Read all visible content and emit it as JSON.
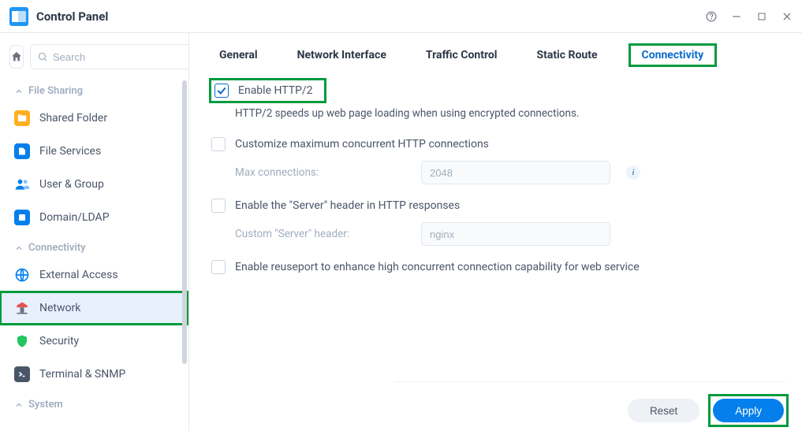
{
  "titlebar": {
    "title": "Control Panel"
  },
  "search": {
    "placeholder": "Search"
  },
  "sections": {
    "file_sharing": {
      "title": "File Sharing"
    },
    "connectivity": {
      "title": "Connectivity"
    },
    "system": {
      "title": "System"
    }
  },
  "nav": {
    "shared_folder": "Shared Folder",
    "file_services": "File Services",
    "user_group": "User & Group",
    "domain_ldap": "Domain/LDAP",
    "external_access": "External Access",
    "network": "Network",
    "security": "Security",
    "terminal_snmp": "Terminal & SNMP"
  },
  "tabs": {
    "general": "General",
    "network_interface": "Network Interface",
    "traffic_control": "Traffic Control",
    "static_route": "Static Route",
    "connectivity": "Connectivity"
  },
  "content": {
    "enable_http2": "Enable HTTP/2",
    "http2_desc": "HTTP/2 speeds up web page loading when using encrypted connections.",
    "customize_max": "Customize maximum concurrent HTTP connections",
    "max_conn_label": "Max connections:",
    "max_conn_value": "2048",
    "enable_server_header": "Enable the \"Server\" header in HTTP responses",
    "custom_header_label": "Custom \"Server\" header:",
    "custom_header_value": "nginx",
    "enable_reuseport": "Enable reuseport to enhance high concurrent connection capability for web service"
  },
  "footer": {
    "reset": "Reset",
    "apply": "Apply"
  }
}
